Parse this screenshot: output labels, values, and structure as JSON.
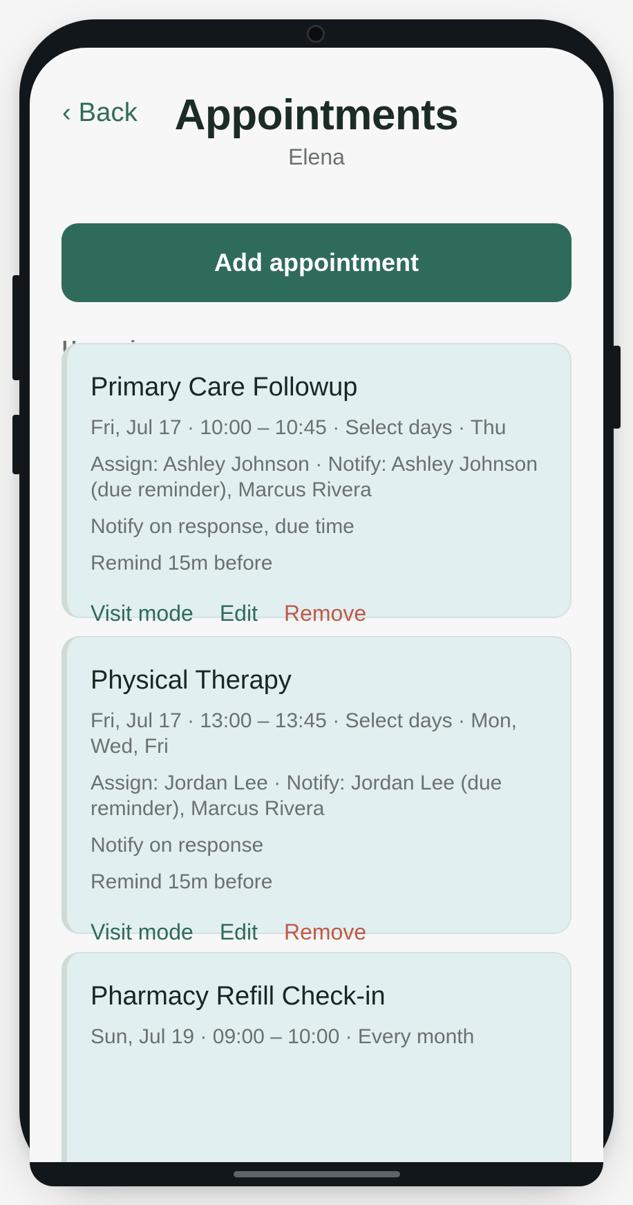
{
  "header": {
    "back_label": "‹ Back",
    "title": "Appointments",
    "subtitle": "Elena"
  },
  "add_button_label": "Add appointment",
  "section_label": "Upcoming",
  "appointments": [
    {
      "title": "Primary Care Followup",
      "schedule": "Fri, Jul 17 · 10:00 – 10:45 · Select days · Thu",
      "assign": "Assign: Ashley Johnson · Notify: Ashley Johnson (due reminder), Marcus Rivera",
      "notify": "Notify on response, due time",
      "remind": "Remind 15m before",
      "actions": {
        "visit": "Visit mode",
        "edit": "Edit",
        "remove": "Remove"
      }
    },
    {
      "title": "Physical Therapy",
      "schedule": "Fri, Jul 17 · 13:00 – 13:45 · Select days · Mon, Wed, Fri",
      "assign": "Assign: Jordan Lee · Notify: Jordan Lee (due reminder), Marcus Rivera",
      "notify": "Notify on response",
      "remind": "Remind 15m before",
      "actions": {
        "visit": "Visit mode",
        "edit": "Edit",
        "remove": "Remove"
      }
    },
    {
      "title": "Pharmacy Refill Check-in",
      "schedule": "Sun, Jul 19 · 09:00 – 10:00 · Every month"
    }
  ],
  "colors": {
    "accent": "#2f6b5a",
    "remove": "#c05a46",
    "card_bg": "#e2eff1",
    "title": "#1c2b26",
    "muted": "#6a716e"
  }
}
